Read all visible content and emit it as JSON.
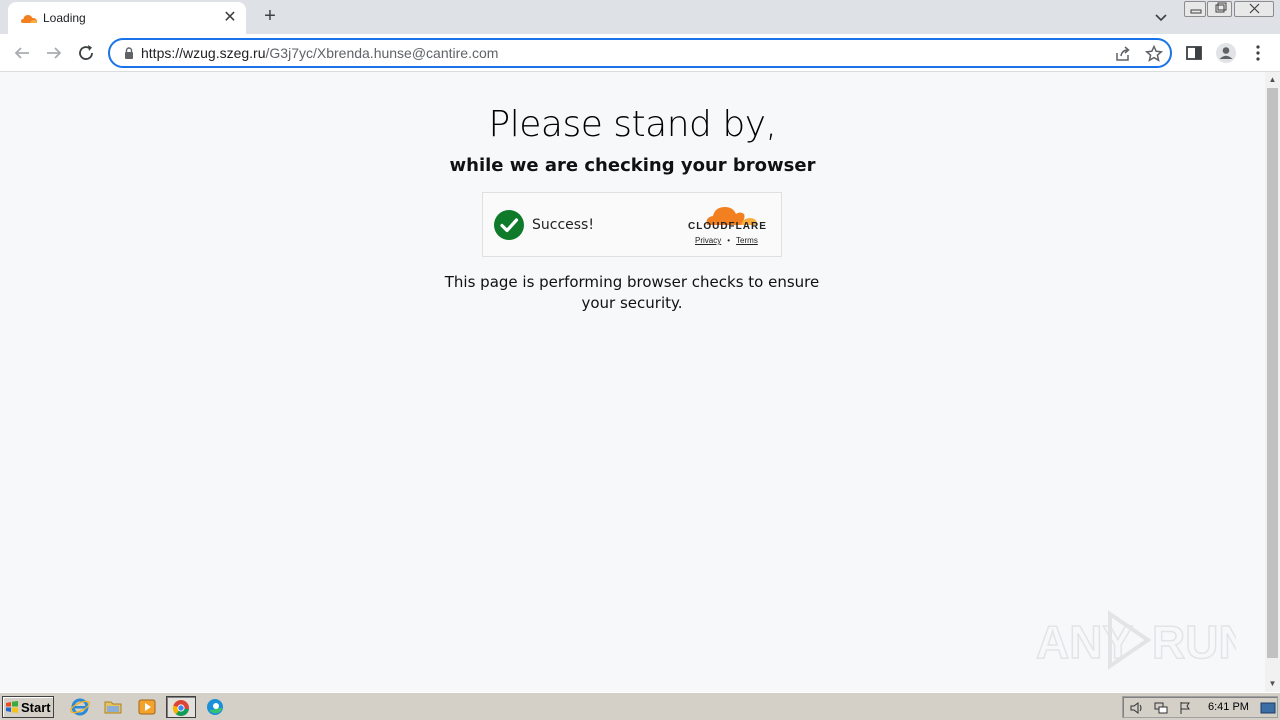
{
  "browser": {
    "tab_title": "Loading",
    "url_host": "https://wzug.szeg.ru",
    "url_path": "/G3j7yc/Xbrenda.hunse@cantire.com"
  },
  "page": {
    "heading": "Please stand by,",
    "subheading": "while we are checking your browser",
    "widget": {
      "status": "Success!",
      "brand": "CLOUDFLARE",
      "privacy": "Privacy",
      "separator": "•",
      "terms": "Terms"
    },
    "description": "This page is performing browser checks to ensure your security.",
    "watermark": "ANY RUN"
  },
  "taskbar": {
    "start_label": "Start",
    "clock": "6:41 PM",
    "apps": [
      "internet-explorer-icon",
      "folder-icon",
      "media-player-icon",
      "chrome-icon",
      "edge-icon"
    ]
  },
  "colors": {
    "accent": "#1a73e8",
    "success": "#0f7a2a",
    "cloudflare_orange": "#f38020"
  }
}
